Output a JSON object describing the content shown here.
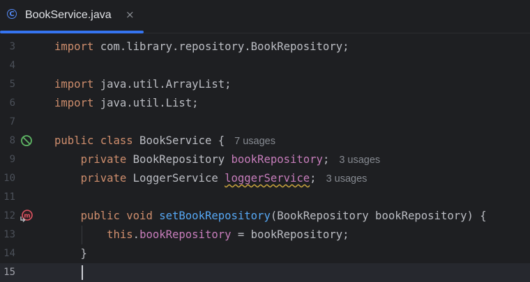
{
  "tab": {
    "title": "BookService.java",
    "icon": "java-class-icon",
    "close": "×"
  },
  "lines": [
    {
      "no": "3",
      "parts": [
        [
          "kw",
          "import"
        ],
        [
          "t",
          " com.library.repository.BookRepository;"
        ]
      ]
    },
    {
      "no": "4",
      "parts": []
    },
    {
      "no": "5",
      "parts": [
        [
          "kw",
          "import"
        ],
        [
          "t",
          " java.util.ArrayList;"
        ]
      ]
    },
    {
      "no": "6",
      "parts": [
        [
          "kw",
          "import"
        ],
        [
          "t",
          " java.util.List;"
        ]
      ]
    },
    {
      "no": "7",
      "parts": []
    },
    {
      "no": "8",
      "parts": [
        [
          "kw",
          "public class"
        ],
        [
          "t",
          " BookService {"
        ],
        [
          "hint",
          "7 usages"
        ]
      ]
    },
    {
      "no": "9",
      "parts": [
        [
          "t",
          "    "
        ],
        [
          "kw",
          "private"
        ],
        [
          "t",
          " BookRepository "
        ],
        [
          "fld",
          "bookRepository"
        ],
        [
          "t",
          ";"
        ],
        [
          "hint",
          "3 usages"
        ]
      ]
    },
    {
      "no": "10",
      "parts": [
        [
          "t",
          "    "
        ],
        [
          "kw",
          "private"
        ],
        [
          "t",
          " LoggerService "
        ],
        [
          "fldsq",
          "loggerService"
        ],
        [
          "t",
          ";"
        ],
        [
          "hint",
          "3 usages"
        ]
      ]
    },
    {
      "no": "11",
      "parts": []
    },
    {
      "no": "12",
      "parts": [
        [
          "t",
          "    "
        ],
        [
          "kw",
          "public void"
        ],
        [
          "t",
          " "
        ],
        [
          "fn",
          "setBookRepository"
        ],
        [
          "t",
          "(BookRepository bookRepository) {"
        ]
      ]
    },
    {
      "no": "13",
      "parts": [
        [
          "t",
          "        "
        ],
        [
          "kw",
          "this"
        ],
        [
          "t",
          "."
        ],
        [
          "fld",
          "bookRepository"
        ],
        [
          "t",
          " = bookRepository;"
        ]
      ]
    },
    {
      "no": "14",
      "parts": [
        [
          "t",
          "    }"
        ]
      ]
    },
    {
      "no": "15",
      "parts": []
    }
  ],
  "gutter": {
    "line8": "no-run-icon",
    "line12": "method-override-icon"
  },
  "colors": {
    "keyword": "#cf8e6d",
    "field": "#c77dbb",
    "method": "#56a8f5",
    "accent": "#3574f0"
  }
}
